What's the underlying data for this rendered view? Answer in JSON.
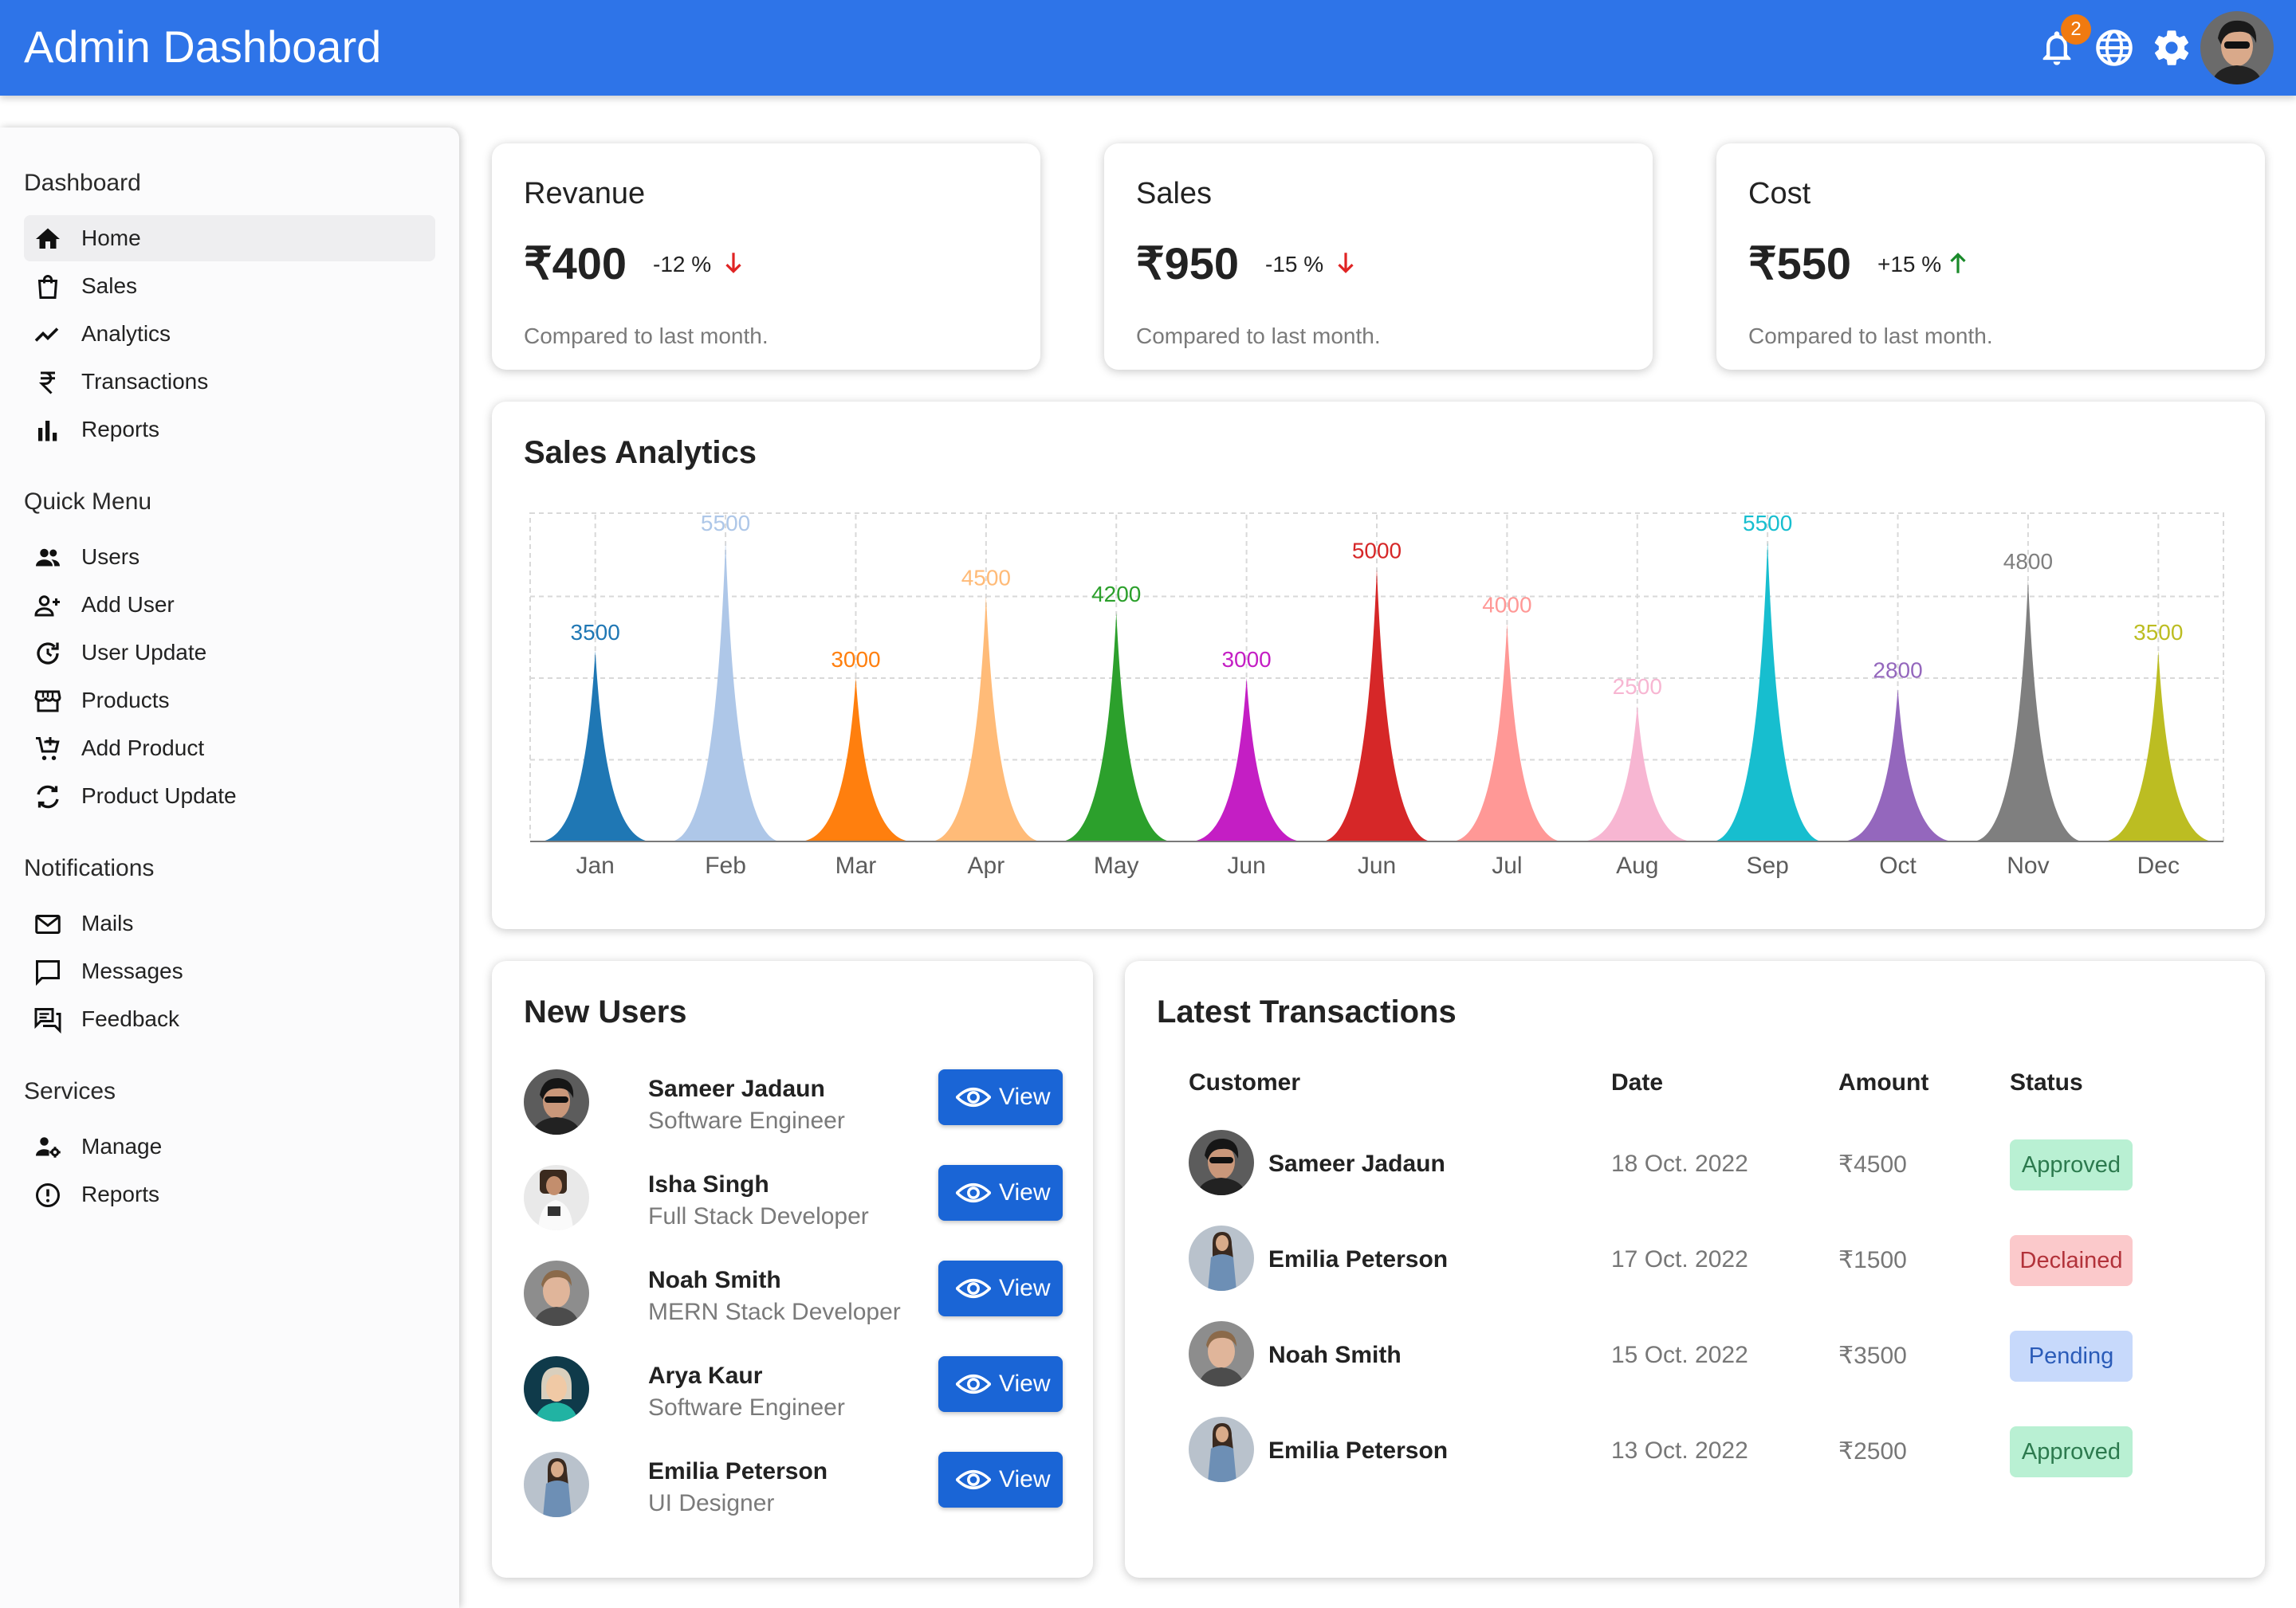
{
  "appbar": {
    "title": "Admin Dashboard",
    "notification_count": "2",
    "icons": [
      "bell-icon",
      "globe-icon",
      "gear-icon",
      "avatar"
    ]
  },
  "sidebar": {
    "sections": [
      {
        "title": "Dashboard",
        "items": [
          {
            "label": "Home",
            "icon": "home-icon",
            "active": true
          },
          {
            "label": "Sales",
            "icon": "shopping-bag-icon"
          },
          {
            "label": "Analytics",
            "icon": "trend-line-icon"
          },
          {
            "label": "Transactions",
            "icon": "rupee-icon"
          },
          {
            "label": "Reports",
            "icon": "bar-chart-icon"
          }
        ]
      },
      {
        "title": "Quick Menu",
        "items": [
          {
            "label": "Users",
            "icon": "users-icon"
          },
          {
            "label": "Add User",
            "icon": "add-user-icon"
          },
          {
            "label": "User Update",
            "icon": "update-icon"
          },
          {
            "label": "Products",
            "icon": "store-icon"
          },
          {
            "label": "Add Product",
            "icon": "add-cart-icon"
          },
          {
            "label": "Product Update",
            "icon": "sync-icon"
          }
        ]
      },
      {
        "title": "Notifications",
        "items": [
          {
            "label": "Mails",
            "icon": "mail-icon"
          },
          {
            "label": "Messages",
            "icon": "message-icon"
          },
          {
            "label": "Feedback",
            "icon": "feedback-icon"
          }
        ]
      },
      {
        "title": "Services",
        "items": [
          {
            "label": "Manage",
            "icon": "manage-icon"
          },
          {
            "label": "Reports",
            "icon": "alert-circle-icon"
          }
        ]
      }
    ]
  },
  "kpis": [
    {
      "title": "Revanue",
      "value": "₹400",
      "change": "-12 %",
      "direction": "down",
      "subtitle": "Compared to last month."
    },
    {
      "title": "Sales",
      "value": "₹950",
      "change": "-15 %",
      "direction": "down",
      "subtitle": "Compared to last month."
    },
    {
      "title": "Cost",
      "value": "₹550",
      "change": "+15 %",
      "direction": "up",
      "subtitle": "Compared to last month."
    }
  ],
  "colors": {
    "appbar": "#2e74e8",
    "button": "#1a65d6",
    "down": "#e02424",
    "up": "#1a8a2a"
  },
  "sales_analytics": {
    "title": "Sales Analytics"
  },
  "chart_data": {
    "type": "area",
    "categories": [
      "Jan",
      "Feb",
      "Mar",
      "Apr",
      "May",
      "Jun",
      "Jun",
      "Jul",
      "Aug",
      "Sep",
      "Oct",
      "Nov",
      "Dec"
    ],
    "values": [
      3500,
      5500,
      3000,
      4500,
      4200,
      3000,
      5000,
      4000,
      2500,
      5500,
      2800,
      4800,
      3500
    ],
    "colors": [
      "#1f77b4",
      "#aec7e8",
      "#ff7f0e",
      "#ffbb78",
      "#2ca02c",
      "#c41ec4",
      "#d62728",
      "#ff9896",
      "#f7b6d2",
      "#17becf",
      "#9467bd",
      "#7f7f7f",
      "#bcbd22"
    ],
    "ylim": [
      0,
      6000
    ],
    "grid": true,
    "title": "Sales Analytics",
    "xlabel": "",
    "ylabel": ""
  },
  "new_users": {
    "title": "New Users",
    "button_label": "View",
    "users": [
      {
        "name": "Sameer Jadaun",
        "role": "Software Engineer"
      },
      {
        "name": "Isha Singh",
        "role": "Full Stack Developer"
      },
      {
        "name": "Noah Smith",
        "role": "MERN Stack Developer"
      },
      {
        "name": "Arya Kaur",
        "role": "Software Engineer"
      },
      {
        "name": "Emilia Peterson",
        "role": "UI Designer"
      }
    ]
  },
  "transactions": {
    "title": "Latest Transactions",
    "headers": [
      "Customer",
      "Date",
      "Amount",
      "Status"
    ],
    "rows": [
      {
        "customer": "Sameer Jadaun",
        "date": "18 Oct. 2022",
        "amount": "₹4500",
        "status": "Approved"
      },
      {
        "customer": "Emilia Peterson",
        "date": "17 Oct. 2022",
        "amount": "₹1500",
        "status": "Declained"
      },
      {
        "customer": "Noah Smith",
        "date": "15 Oct. 2022",
        "amount": "₹3500",
        "status": "Pending"
      },
      {
        "customer": "Emilia Peterson",
        "date": "13 Oct. 2022",
        "amount": "₹2500",
        "status": "Approved"
      }
    ]
  }
}
